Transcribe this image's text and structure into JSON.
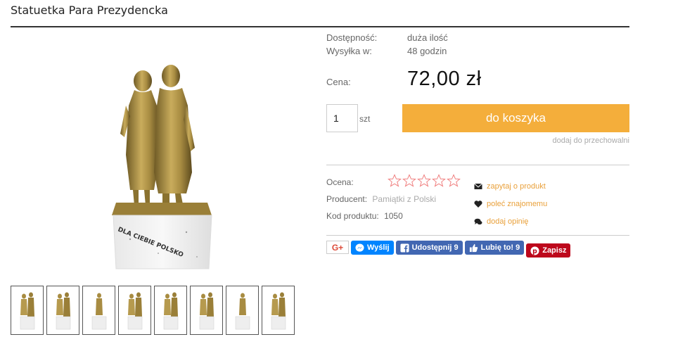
{
  "product": {
    "title": "Statuetka Para Prezydencka",
    "availability_label": "Dostępność:",
    "availability_value": "duża ilość",
    "shipping_label": "Wysyłka w:",
    "shipping_value": "48 godzin",
    "price_label": "Cena:",
    "price_value": "72,00 zł",
    "quantity": "1",
    "unit": "szt",
    "add_to_cart": "do koszyka",
    "add_to_storage": "dodaj do przechowalni",
    "rating_label": "Ocena:",
    "rating_value": 0,
    "rating_max": 5,
    "producer_label": "Producent:",
    "producer_value": "Pamiątki z Polski",
    "code_label": "Kod produktu:",
    "code_value": "1050",
    "image_inscription": "DLA CIEBIE POLSKO"
  },
  "actions": {
    "ask": "zapytaj o produkt",
    "recommend": "poleć znajomemu",
    "review": "dodaj opinię"
  },
  "social": {
    "gplus": "G+",
    "send": "Wyślij",
    "share": "Udostępnij 9",
    "like": "Lubię to! 9",
    "save": "Zapisz"
  },
  "icons": {
    "ask": "envelope-icon",
    "recommend": "heart-icon",
    "review": "comments-icon",
    "rating": "star-outline-icon"
  },
  "colors": {
    "accent": "#f4ae3b",
    "link": "#e9a03a",
    "star": "#f08080",
    "messenger": "#0084ff",
    "facebook": "#4267b2",
    "pinterest": "#bd081c"
  },
  "thumbnails": [
    "thumb-1",
    "thumb-2",
    "thumb-3",
    "thumb-4",
    "thumb-5",
    "thumb-6",
    "thumb-7",
    "thumb-8"
  ]
}
